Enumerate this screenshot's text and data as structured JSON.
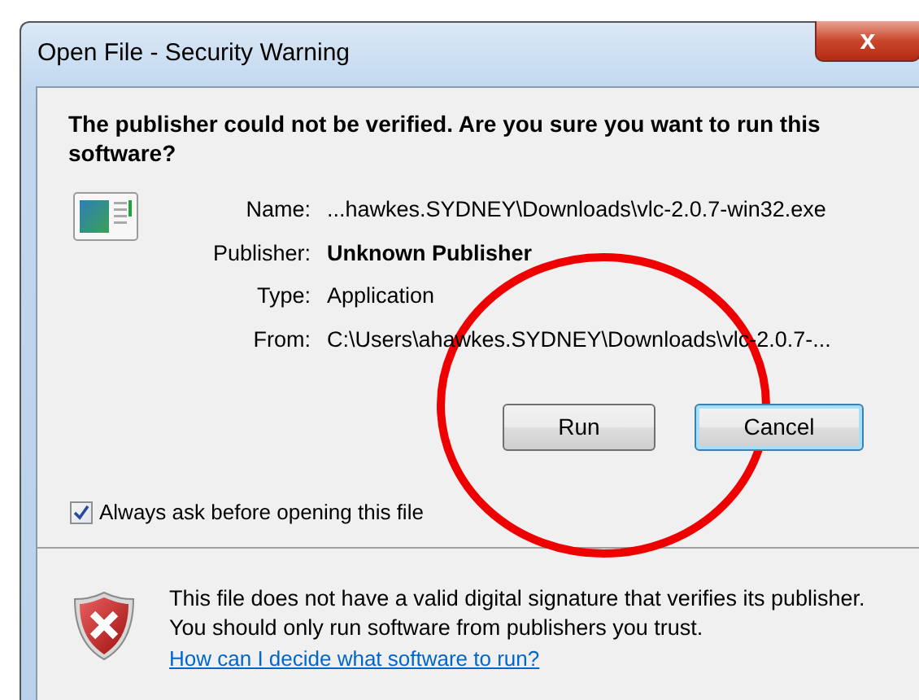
{
  "window": {
    "title": "Open File - Security Warning",
    "close_label": "x"
  },
  "heading": "The publisher could not be verified.  Are you sure you want to run this software?",
  "details": [
    {
      "label": "Name:",
      "value": "...hawkes.SYDNEY\\Downloads\\vlc-2.0.7-win32.exe",
      "bold": false
    },
    {
      "label": "Publisher:",
      "value": "Unknown Publisher",
      "bold": true
    },
    {
      "label": "Type:",
      "value": "Application",
      "bold": false
    },
    {
      "label": "From:",
      "value": "C:\\Users\\ahawkes.SYDNEY\\Downloads\\vlc-2.0.7-...",
      "bold": false
    }
  ],
  "buttons": [
    {
      "label": "Run",
      "default": false
    },
    {
      "label": "Cancel",
      "default": true
    }
  ],
  "checkbox": {
    "label": "Always ask before opening this file",
    "checked": true
  },
  "warning": {
    "text": "This file does not have a valid digital signature that verifies its publisher.  You should only run software from publishers you trust.",
    "link": "How can I decide what software to run?"
  },
  "annotation": {
    "kind": "circle"
  }
}
